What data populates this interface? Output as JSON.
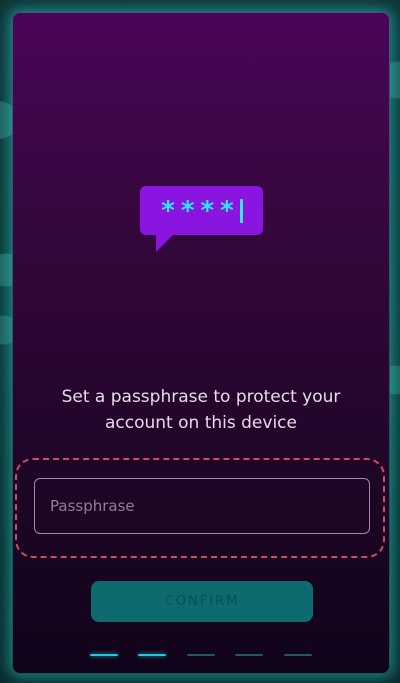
{
  "bubble": {
    "pin_mask": "****"
  },
  "prompt": {
    "line1": "Set a passphrase to protect your",
    "line2": "account on this device"
  },
  "passphrase_field": {
    "value": "",
    "placeholder": "Passphrase"
  },
  "confirm_button": {
    "label": "CONFIRM",
    "enabled": false
  },
  "steps": {
    "total": 5,
    "completed": 2
  },
  "colors": {
    "accent_cyan": "#2ee6ff",
    "bubble_purple": "#8a14e0",
    "card_top": "#4a0557",
    "card_bottom": "#10041a",
    "button_teal": "#0d6b6f",
    "highlight_dashed": "#d04a63"
  },
  "icons": {
    "bubble_icon": "password-chat-bubble-icon"
  }
}
